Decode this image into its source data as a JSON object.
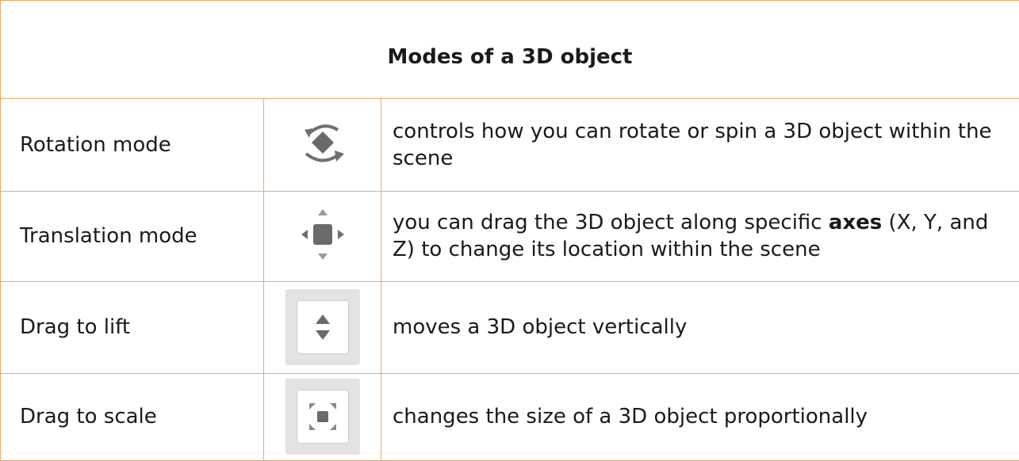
{
  "title": "Modes of a 3D object",
  "rows": [
    {
      "label": "Rotation mode",
      "icon": "rotation-mode-icon",
      "description_parts": [
        "controls how you can rotate or spin a 3D object within the scene"
      ]
    },
    {
      "label": "Translation mode",
      "icon": "translation-mode-icon",
      "description_parts": [
        "you can drag the 3D object along specific ",
        "axes",
        " (X, Y, and Z) to change its location within the scene"
      ]
    },
    {
      "label": "Drag to lift",
      "icon": "drag-to-lift-icon",
      "description_parts": [
        "moves a 3D object vertically"
      ]
    },
    {
      "label": "Drag to scale",
      "icon": "drag-to-scale-icon",
      "description_parts": [
        "changes the size of a 3D object proportionally"
      ]
    }
  ],
  "colors": {
    "border": "#f0a868",
    "icon_gray": "#6e6e6e",
    "text": "#1a1a1a"
  }
}
